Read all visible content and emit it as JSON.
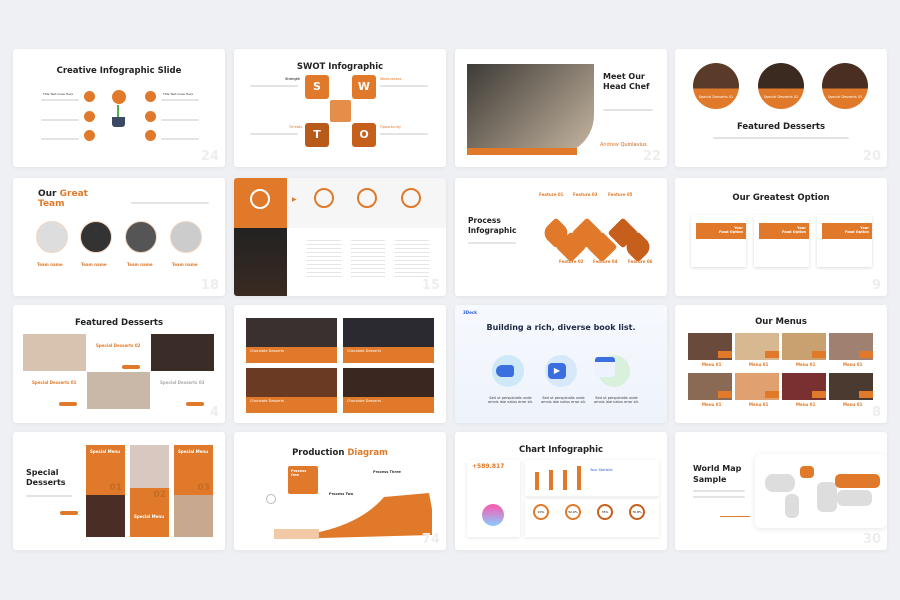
{
  "accent_color": "#e07a2a",
  "accent_dark": "#c65f1c",
  "slides": {
    "s1": {
      "title": "Creative Infographic Slide",
      "number": "24",
      "item": "Title Text Goes Here",
      "icon": "lightbulb-plant-icon"
    },
    "s2": {
      "title": "SWOT Infographic",
      "letters": [
        "S",
        "W",
        "T",
        "O"
      ],
      "labels": [
        "Strength",
        "Weaknesses",
        "Threats",
        "Opportunity"
      ]
    },
    "s3": {
      "title_line1": "Meet Our",
      "title_line2": "Head Chef",
      "name_first": "Andrew",
      "name_last": "Quinlavius",
      "number": "22"
    },
    "s4": {
      "title": "Featured Desserts",
      "captions": [
        "Special Desserts 01",
        "Special Desserts 02",
        "Special Desserts 03"
      ],
      "number": "20"
    },
    "s5": {
      "title_dark": "Our",
      "title_orange": "Great Team",
      "member": "Team name",
      "number": "18"
    },
    "s6": {
      "number": "15"
    },
    "s7": {
      "title_line1": "Process",
      "title_line2": "Infographic",
      "features_top": [
        "Feature 01",
        "Feature 03",
        "Feature 05"
      ],
      "features_bottom": [
        "Feature 02",
        "Feature 04",
        "Feature 06"
      ]
    },
    "s8": {
      "title": "Our Greatest Option",
      "card_label_1": "Your",
      "card_label_2": "Food Option",
      "number": "9"
    },
    "s9": {
      "title": "Featured Desserts",
      "captions": [
        "Special Desserts 02",
        "Special Desserts 01",
        "Special Desserts 03"
      ],
      "number": "4"
    },
    "s10": {
      "card": "Chocolate Desserts"
    },
    "s11": {
      "logo": "3Deck",
      "title": "Building a rich, diverse book list.",
      "caption": "Sed ut perspiciatis unde omnis iste natus error sit.",
      "icons": [
        "megaphone-icon",
        "play-icon",
        "calendar-icon"
      ]
    },
    "s12": {
      "title": "Our Menus",
      "item": "Menu 01",
      "number": "8"
    },
    "s13": {
      "title_line1": "Special",
      "title_line2": "Desserts",
      "menu": "Special Menu",
      "nums": [
        "01",
        "02",
        "03"
      ]
    },
    "s14": {
      "title_dark": "Production",
      "title_orange": "Diagram",
      "steps": [
        "Process One",
        "Process Two",
        "Process Three"
      ],
      "number": "74"
    },
    "s15": {
      "title": "Chart Infographic",
      "stat": "+589.817",
      "stats_title": "Your Statistic",
      "donuts": [
        "20%",
        "52.6%",
        "35%",
        "76.8%"
      ]
    },
    "s16": {
      "title_line1": "World Map",
      "title_line2": "Sample",
      "number": "30"
    }
  }
}
